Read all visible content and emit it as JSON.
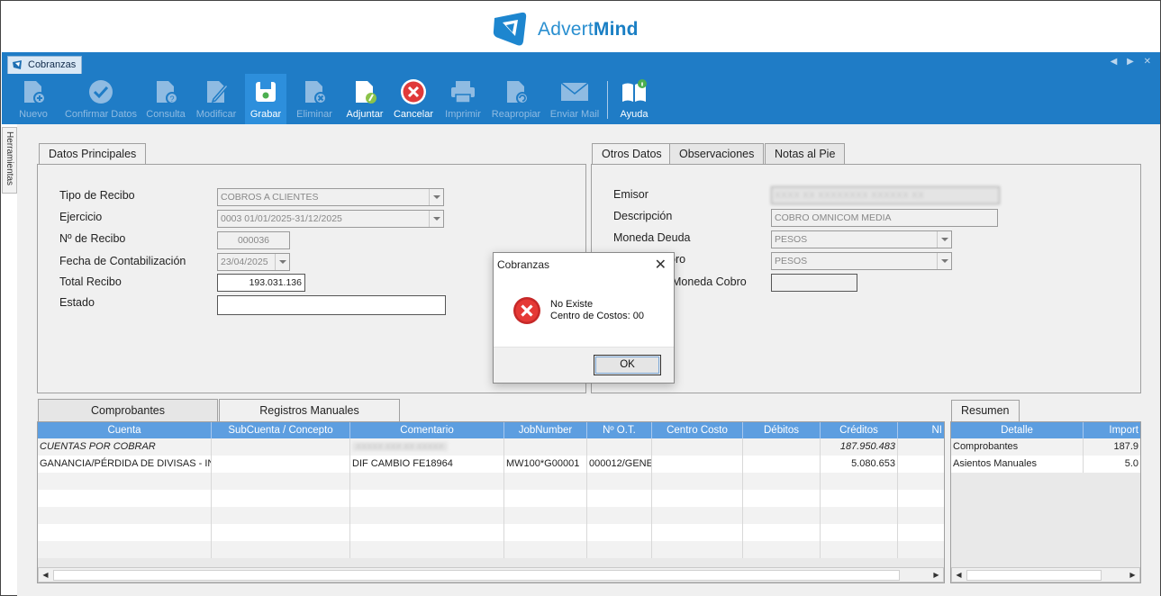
{
  "app": {
    "logo_text_light": "Advert",
    "logo_text_bold": "Mind"
  },
  "colors": {
    "accent": "#1f7cc6",
    "grid_header": "#5d9ee0",
    "error": "#e03a3a"
  },
  "window": {
    "tab_label": "Cobranzas",
    "side_tab": "Herramientas"
  },
  "toolbar": {
    "nuevo": "Nuevo",
    "confirmar": "Confirmar Datos",
    "consulta": "Consulta",
    "modificar": "Modificar",
    "grabar": "Grabar",
    "eliminar": "Eliminar",
    "adjuntar": "Adjuntar",
    "cancelar": "Cancelar",
    "imprimir": "Imprimir",
    "reapropiar": "Reapropiar",
    "enviar_mail": "Enviar Mail",
    "ayuda": "Ayuda"
  },
  "datos_principales": {
    "tab": "Datos Principales",
    "tipo_recibo_label": "Tipo de Recibo",
    "tipo_recibo_value": "COBROS A CLIENTES",
    "ejercicio_label": "Ejercicio",
    "ejercicio_value": "0003 01/01/2025-31/12/2025",
    "nro_recibo_label": "Nº de Recibo",
    "nro_recibo_value": "000036",
    "fecha_label": "Fecha de Contabilización",
    "fecha_value": "23/04/2025",
    "total_label": "Total Recibo",
    "total_value": "193.031.136",
    "estado_label": "Estado",
    "estado_value": ""
  },
  "otros_datos": {
    "tabs": [
      "Otros Datos",
      "Observaciones",
      "Notas al Pie"
    ],
    "emisor_label": "Emisor",
    "emisor_value": "XXXX XX XXXXXXXX XXXXXX XX",
    "descripcion_label": "Descripción",
    "descripcion_value": "COBRO OMNICOM MEDIA",
    "moneda_deuda_label": "Moneda Deuda",
    "moneda_deuda_value": "PESOS",
    "moneda_cobro_label": "oro",
    "moneda_cobro_value": "PESOS",
    "cotiz_label": "Moneda Cobro",
    "cotiz_value": ""
  },
  "registros": {
    "tabs": [
      "Comprobantes",
      "Registros Manuales"
    ],
    "columns": [
      "Cuenta",
      "SubCuenta / Concepto",
      "Comentario",
      "JobNumber",
      "Nº O.T.",
      "Centro Costo",
      "Débitos",
      "Créditos",
      "NI"
    ],
    "rows": [
      {
        "cuenta": "CUENTAS POR COBRAR",
        "subcuenta": "",
        "comentario": "XXXXX XXX XX XXXXX",
        "job": "",
        "ot": "",
        "centro": "",
        "debitos": "",
        "creditos": "187.950.483"
      },
      {
        "cuenta": "GANANCIA/PÉRDIDA DE DIVISAS - INGRESO",
        "subcuenta": "",
        "comentario": "DIF CAMBIO FE18964",
        "job": "MW100*G00001",
        "ot": "000012/GENE",
        "centro": "",
        "debitos": "",
        "creditos": "5.080.653"
      }
    ]
  },
  "resumen": {
    "tab": "Resumen",
    "columns": [
      "Detalle",
      "Import"
    ],
    "rows": [
      {
        "detalle": "Comprobantes",
        "importe": "187.9"
      },
      {
        "detalle": "Asientos Manuales",
        "importe": "5.0"
      }
    ]
  },
  "dialog": {
    "title": "Cobranzas",
    "line1": "No Existe",
    "line2": "Centro de Costos: 00",
    "ok": "OK"
  }
}
